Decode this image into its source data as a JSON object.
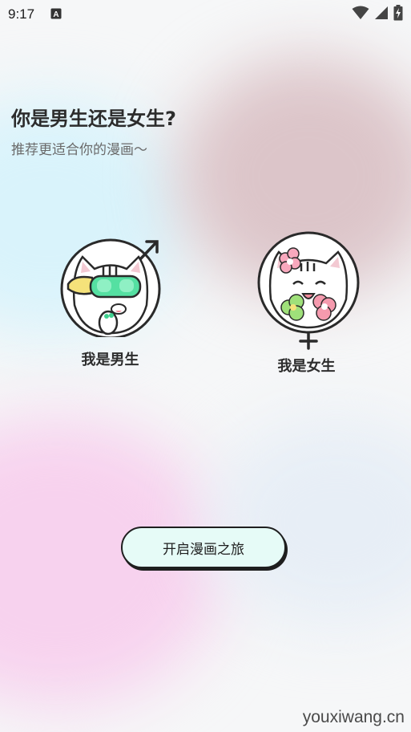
{
  "status_bar": {
    "time": "9:17",
    "notification_icon": "a-box-icon",
    "icons": [
      "wifi-icon",
      "signal-icon",
      "battery-charging-icon"
    ]
  },
  "header": {
    "title": "你是男生还是女生?",
    "subtitle": "推荐更适合你的漫画～"
  },
  "choices": {
    "male": {
      "label": "我是男生",
      "icon": "male-symbol-icon"
    },
    "female": {
      "label": "我是女生",
      "icon": "female-symbol-icon"
    }
  },
  "start_button": {
    "label": "开启漫画之旅"
  },
  "watermark": "youxiwang.cn",
  "colors": {
    "accent_button_bg": "#e6fbf7",
    "text_primary": "#2c2c2c",
    "text_secondary": "#6a6a6a"
  }
}
